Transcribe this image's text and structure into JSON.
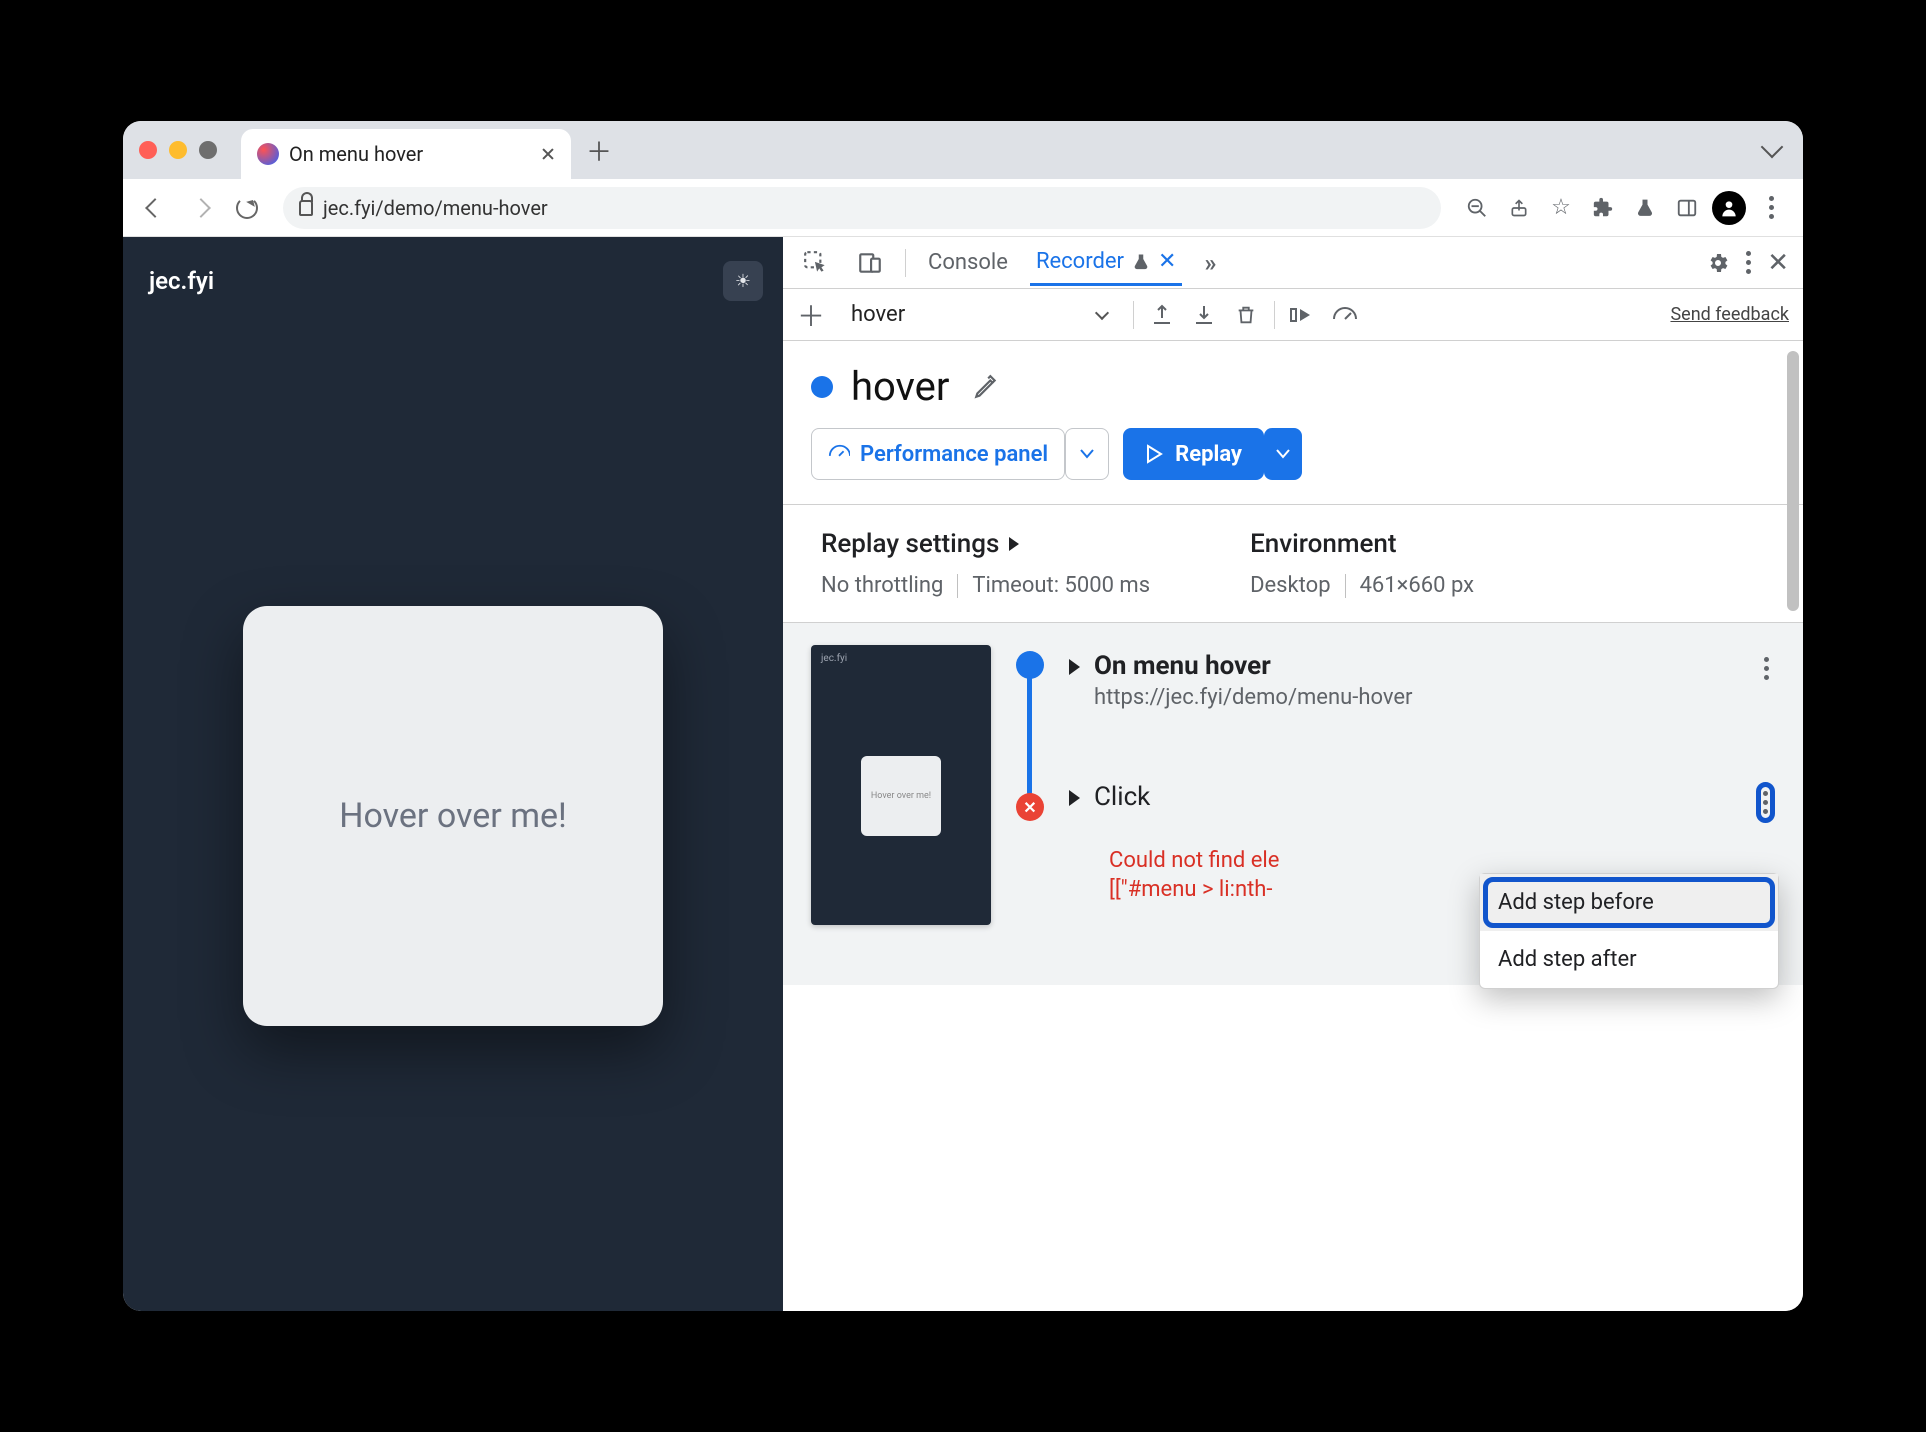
{
  "browser": {
    "tab_title": "On menu hover",
    "url": "jec.fyi/demo/menu-hover"
  },
  "page": {
    "brand": "jec.fyi",
    "hover_text": "Hover over me!",
    "thumb_text": "Hover over me!"
  },
  "devtools": {
    "tabs": {
      "console": "Console",
      "recorder": "Recorder"
    },
    "recording_select": "hover",
    "feedback_label": "Send feedback",
    "recording_title": "hover",
    "perf_panel_label": "Performance panel",
    "replay_label": "Replay",
    "settings": {
      "replay_heading": "Replay settings",
      "throttling": "No throttling",
      "timeout": "Timeout: 5000 ms",
      "env_heading": "Environment",
      "device": "Desktop",
      "dimensions": "461×660 px"
    },
    "steps": {
      "step1_title": "On menu hover",
      "step1_url": "https://jec.fyi/demo/menu-hover",
      "step2_title": "Click",
      "error_line1": "Could not find ele",
      "error_line2": "[[\"#menu > li:nth-"
    },
    "context_menu": {
      "before": "Add step before",
      "after": "Add step after"
    }
  }
}
